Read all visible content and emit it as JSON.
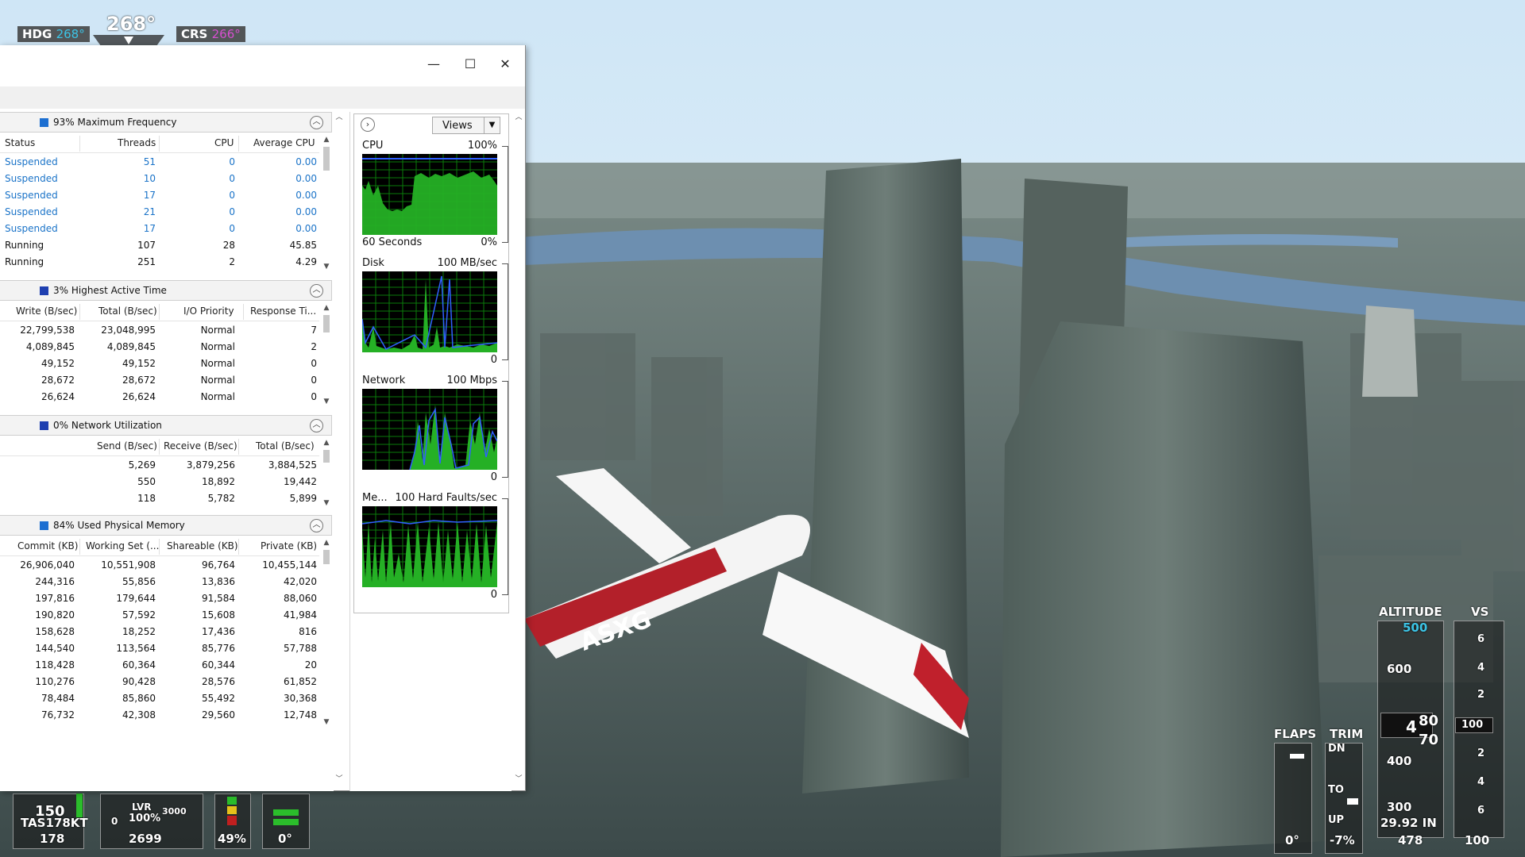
{
  "hud": {
    "hdg_label": "HDG",
    "hdg_value": "268°",
    "heading_big": "268°",
    "crs_label": "CRS",
    "crs_value": "266°"
  },
  "aircraft": {
    "registration": "ASXG"
  },
  "bottom_gauges": {
    "airspeed_scale": "150",
    "tas": "TAS178KT",
    "tas_value": "178",
    "lever_zero": "0",
    "lever_label": "LVR",
    "lever_pct": "100%",
    "rpm_max": "3000",
    "rpm": "2699",
    "fuel_pct": "49%",
    "trim_deg": "0°"
  },
  "right_hud": {
    "flaps": "FLAPS",
    "flaps_value": "0°",
    "trim": "TRIM",
    "trim_dn": "DN",
    "trim_to": "TO",
    "trim_up": "UP",
    "trim_value": "-7%",
    "altitude": "ALTITUDE",
    "alt_selected": "500",
    "alt_600": "600",
    "alt_400": "400",
    "alt_300": "300",
    "alt_hundreds": "4",
    "alt_80": "80",
    "alt_70": "70",
    "baro": "29.92 IN",
    "alt_bottom": "478",
    "vs": "VS",
    "vs_6a": "6",
    "vs_4a": "4",
    "vs_2a": "2",
    "vs_2b": "2",
    "vs_4b": "4",
    "vs_6b": "6",
    "vs_current": "100",
    "vs_bottom": "100",
    "flaps_indicator": 0.08,
    "trim_indicator": 0.55
  },
  "window": {
    "minimize_glyph": "—",
    "maximize_glyph": "☐",
    "close_glyph": "✕"
  },
  "cpu_section": {
    "title": "93% Maximum Frequency",
    "color": "#1d6fd1",
    "columns": [
      "Status",
      "Threads",
      "CPU",
      "Average CPU"
    ],
    "rows": [
      [
        "Suspended",
        "51",
        "0",
        "0.00"
      ],
      [
        "Suspended",
        "10",
        "0",
        "0.00"
      ],
      [
        "Suspended",
        "17",
        "0",
        "0.00"
      ],
      [
        "Suspended",
        "21",
        "0",
        "0.00"
      ],
      [
        "Suspended",
        "17",
        "0",
        "0.00"
      ],
      [
        "Running",
        "107",
        "28",
        "45.85"
      ],
      [
        "Running",
        "251",
        "2",
        "4.29"
      ]
    ]
  },
  "disk_section": {
    "title": "3% Highest Active Time",
    "color": "#1e3fb0",
    "columns": [
      "Write (B/sec)",
      "Total (B/sec)",
      "I/O Priority",
      "Response Ti..."
    ],
    "rows": [
      [
        "22,799,538",
        "23,048,995",
        "Normal",
        "7"
      ],
      [
        "4,089,845",
        "4,089,845",
        "Normal",
        "2"
      ],
      [
        "49,152",
        "49,152",
        "Normal",
        "0"
      ],
      [
        "28,672",
        "28,672",
        "Normal",
        "0"
      ],
      [
        "26,624",
        "26,624",
        "Normal",
        "0"
      ]
    ]
  },
  "network_section": {
    "title": "0% Network Utilization",
    "color": "#1e3fb0",
    "columns": [
      "Send (B/sec)",
      "Receive (B/sec)",
      "Total (B/sec)"
    ],
    "rows": [
      [
        "5,269",
        "3,879,256",
        "3,884,525"
      ],
      [
        "550",
        "18,892",
        "19,442"
      ],
      [
        "118",
        "5,782",
        "5,899"
      ]
    ]
  },
  "memory_section": {
    "title": "84% Used Physical Memory",
    "color": "#1d6fd1",
    "columns": [
      "Commit (KB)",
      "Working Set (...",
      "Shareable (KB)",
      "Private (KB)"
    ],
    "rows": [
      [
        "26,906,040",
        "10,551,908",
        "96,764",
        "10,455,144"
      ],
      [
        "244,316",
        "55,856",
        "13,836",
        "42,020"
      ],
      [
        "197,816",
        "179,644",
        "91,584",
        "88,060"
      ],
      [
        "190,820",
        "57,592",
        "15,608",
        "41,984"
      ],
      [
        "158,628",
        "18,252",
        "17,436",
        "816"
      ],
      [
        "144,540",
        "113,564",
        "85,776",
        "57,788"
      ],
      [
        "118,428",
        "60,364",
        "60,344",
        "20"
      ],
      [
        "110,276",
        "90,428",
        "28,576",
        "61,852"
      ],
      [
        "78,484",
        "85,860",
        "55,492",
        "30,368"
      ],
      [
        "76,732",
        "42,308",
        "29,560",
        "12,748"
      ]
    ]
  },
  "graphs_panel": {
    "views_label": "Views",
    "cpu": {
      "label": "CPU",
      "max": "100%",
      "time": "60 Seconds",
      "min": "0%"
    },
    "disk": {
      "label": "Disk",
      "max": "100 MB/sec",
      "min": "0"
    },
    "network": {
      "label": "Network",
      "max": "100 Mbps",
      "min": "0"
    },
    "memory": {
      "label": "Me...",
      "max": "100 Hard Faults/sec",
      "min": "0"
    }
  },
  "colors": {
    "graph_bg": "#000000",
    "graph_grid": "#0a7a0a",
    "graph_fill": "#25b025",
    "graph_line_blue": "#3060ff",
    "link_blue": "#1a73c8"
  }
}
